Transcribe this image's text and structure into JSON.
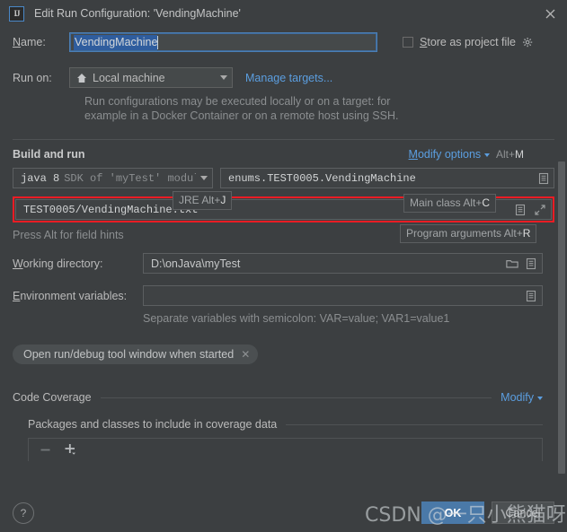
{
  "window": {
    "title": "Edit Run Configuration: 'VendingMachine'",
    "logo": "IJ",
    "close_icon": "close-icon"
  },
  "name_row": {
    "label": "Name:",
    "label_mnemonic": "N",
    "value": "VendingMachine",
    "store_as_project_file_label": "Store as project file",
    "store_mnemonic": "S",
    "gear_icon": "gear-icon"
  },
  "run_on": {
    "label": "Run on:",
    "selected": "Local machine",
    "machine_icon": "home-icon",
    "manage_targets_link": "Manage targets...",
    "description_line1": "Run configurations may be executed locally or on a target: for",
    "description_line2": "example in a Docker Container or on a remote host using SSH."
  },
  "build_and_run": {
    "section_title": "Build and run",
    "modify_options_link": "Modify options",
    "modify_options_mnemonic": "M",
    "modify_options_shortcut_prefix": "Alt+",
    "modify_options_shortcut_key": "M",
    "jre_hint_label": "JRE Alt+",
    "jre_hint_key": "J",
    "main_class_hint_label": "Main class Alt+",
    "main_class_hint_key": "C",
    "program_args_hint_label": "Program arguments Alt+",
    "program_args_hint_key": "R",
    "jre_main_text": "java 8",
    "jre_sub_text": "SDK of 'myTest' module",
    "main_class_value": "enums.TEST0005.VendingMachine",
    "main_class_browse_icon": "list-browse-icon",
    "program_arguments_value": "TEST0005/VendingMachine.txt",
    "program_args_expand_icon": "expand-icon",
    "program_args_list_icon": "list-browse-icon",
    "press_alt_hint": "Press Alt for field hints",
    "highlight_color": "#ed1c24"
  },
  "working_directory": {
    "label": "Working directory:",
    "label_mnemonic": "W",
    "value": "D:\\onJava\\myTest",
    "folder_icon": "folder-icon",
    "list_icon": "list-browse-icon"
  },
  "environment_variables": {
    "label": "Environment variables:",
    "label_mnemonic": "E",
    "value": "",
    "list_icon": "list-browse-icon",
    "hint": "Separate variables with semicolon: VAR=value; VAR1=value1"
  },
  "option_chip": {
    "label": "Open run/debug tool window when started",
    "remove_icon": "close-icon"
  },
  "code_coverage": {
    "title": "Code Coverage",
    "modify_link": "Modify",
    "packages_title": "Packages and classes to include in coverage data",
    "remove_icon": "minus-icon",
    "add_icon": "plus-icon"
  },
  "footer": {
    "help_label": "?",
    "ok_label": "OK",
    "cancel_label": "Cancel"
  },
  "watermark": {
    "text": "CSDN @一只小熊猫呀"
  }
}
